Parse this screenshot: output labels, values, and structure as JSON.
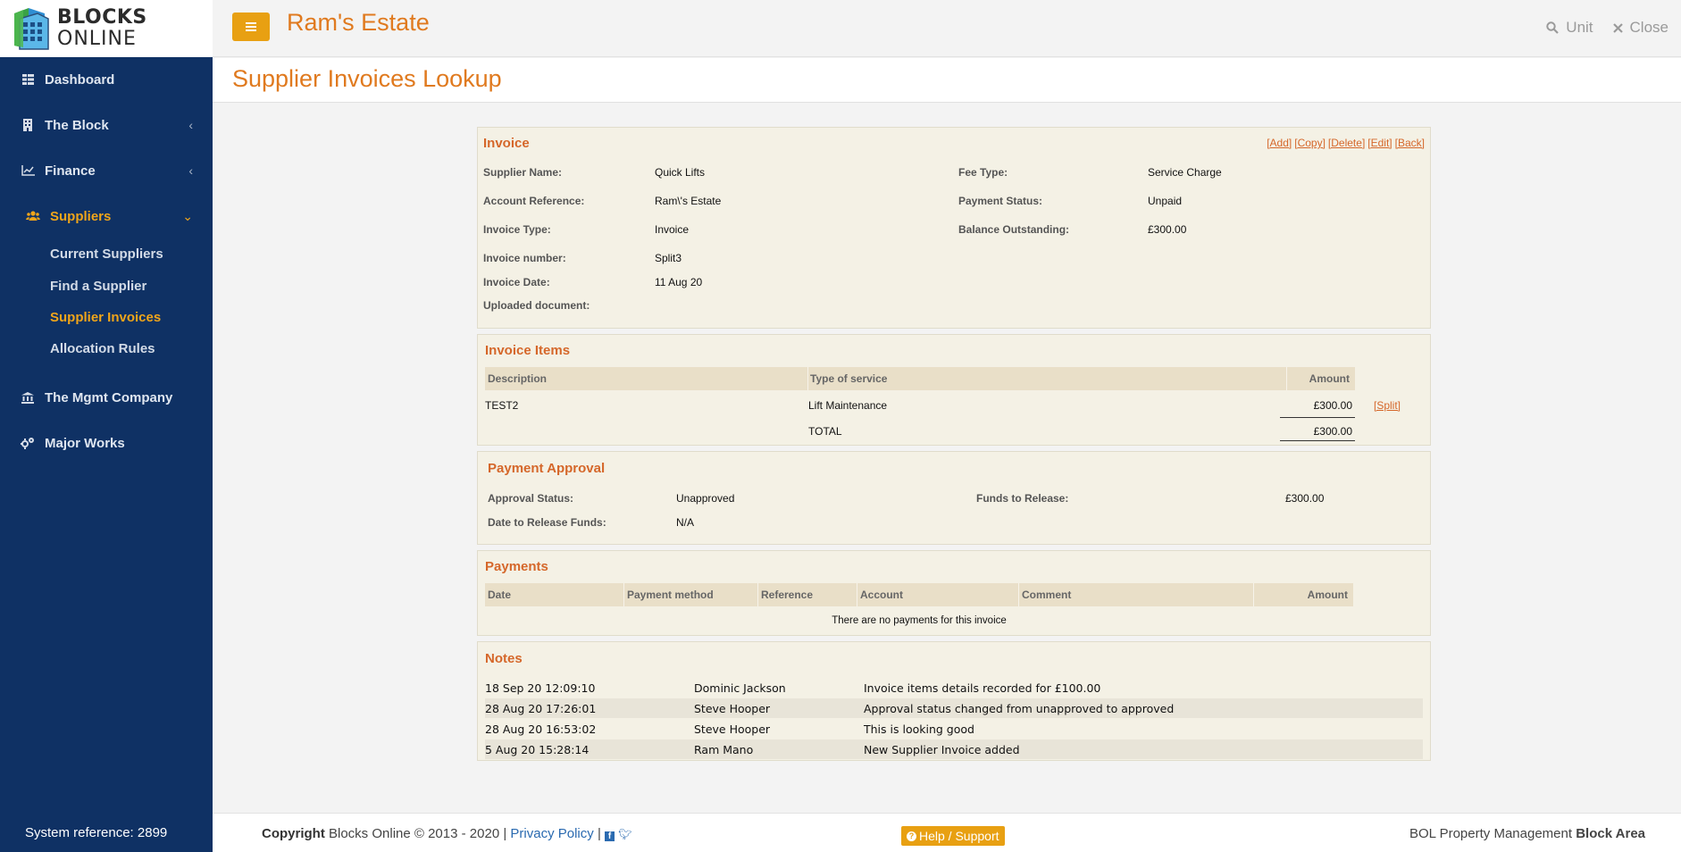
{
  "app": {
    "logo_line1": "BLOCKS",
    "logo_line2": "ONLINE",
    "estate_name": "Ram's Estate",
    "page_title": "Supplier Invoices Lookup"
  },
  "topbar": {
    "unit_label": "Unit",
    "close_label": "Close"
  },
  "sidebar": {
    "items": [
      {
        "label": "Dashboard",
        "icon": "dashboard-icon"
      },
      {
        "label": "The Block",
        "icon": "building-icon"
      },
      {
        "label": "Finance",
        "icon": "chart-line-icon"
      },
      {
        "label": "Suppliers",
        "icon": "users-icon"
      },
      {
        "label": "The Mgmt Company",
        "icon": "bank-icon"
      },
      {
        "label": "Major Works",
        "icon": "cogs-icon"
      }
    ],
    "sub_items": [
      {
        "label": "Current Suppliers"
      },
      {
        "label": "Find a Supplier"
      },
      {
        "label": "Supplier Invoices"
      },
      {
        "label": "Allocation Rules"
      }
    ],
    "system_reference": "System reference: 2899"
  },
  "invoice": {
    "title": "Invoice",
    "actions": [
      "[Add]",
      "[Copy]",
      "[Delete]",
      "[Edit]",
      "[Back]"
    ],
    "supplier_name_label": "Supplier Name:",
    "supplier_name": "Quick Lifts",
    "account_ref_label": "Account Reference:",
    "account_ref": "Ram\\'s Estate",
    "invoice_type_label": "Invoice Type:",
    "invoice_type": "Invoice",
    "invoice_number_label": "Invoice number:",
    "invoice_number": "Split3",
    "invoice_date_label": "Invoice Date:",
    "invoice_date": "11 Aug 20",
    "uploaded_doc_label": "Uploaded document:",
    "fee_type_label": "Fee Type:",
    "fee_type": "Service Charge",
    "payment_status_label": "Payment Status:",
    "payment_status": "Unpaid",
    "balance_label": "Balance Outstanding:",
    "balance": "£300.00"
  },
  "items": {
    "title": "Invoice Items",
    "headers": [
      "Description",
      "Type of service",
      "Amount"
    ],
    "rows": [
      {
        "description": "TEST2",
        "service": "Lift Maintenance",
        "amount": "£300.00",
        "action": "[Split]"
      }
    ],
    "total_label": "TOTAL",
    "total": "£300.00"
  },
  "approval": {
    "title": "Payment Approval",
    "status_label": "Approval Status:",
    "status": "Unapproved",
    "release_date_label": "Date to Release Funds:",
    "release_date": "N/A",
    "funds_label": "Funds to Release:",
    "funds": "£300.00"
  },
  "payments": {
    "title": "Payments",
    "headers": [
      "Date",
      "Payment method",
      "Reference",
      "Account",
      "Comment",
      "Amount"
    ],
    "empty_message": "There are no payments for this invoice"
  },
  "notes": {
    "title": "Notes",
    "rows": [
      {
        "date": "18 Sep 20 12:09:10",
        "user": "Dominic Jackson",
        "text": "Invoice items details recorded for £100.00"
      },
      {
        "date": "28 Aug 20 17:26:01",
        "user": "Steve Hooper",
        "text": "Approval status changed from unapproved to approved"
      },
      {
        "date": "28 Aug 20 16:53:02",
        "user": "Steve Hooper",
        "text": "This is looking good"
      },
      {
        "date": "5 Aug 20 15:28:14",
        "user": "Ram Mano",
        "text": "New Supplier Invoice added"
      }
    ]
  },
  "footer": {
    "copyright_bold": "Copyright",
    "copyright_text": "Blocks Online © 2013 - 2020 |",
    "privacy": "Privacy Policy",
    "separator": "|",
    "help": "Help / Support",
    "right_text": "BOL Property Management",
    "right_bold": "Block Area"
  },
  "colors": {
    "sidebar_bg": "#0f3164",
    "accent": "#e8a012",
    "title_orange": "#e07a1f",
    "panel_bg": "#f4f1e5"
  }
}
